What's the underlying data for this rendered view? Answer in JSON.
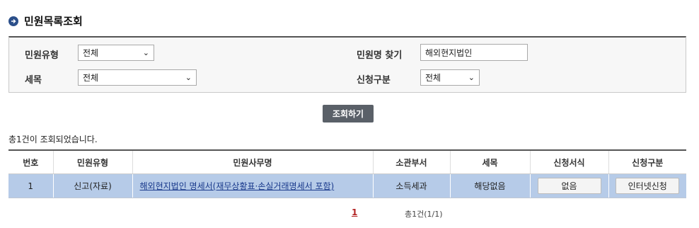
{
  "page": {
    "title": "민원목록조회"
  },
  "search": {
    "type_label": "민원유형",
    "type_value": "전체",
    "name_label": "민원명 찾기",
    "name_value": "해외현지법인",
    "tax_label": "세목",
    "tax_value": "전체",
    "apply_label": "신청구분",
    "apply_value": "전체",
    "button": "조회하기"
  },
  "result": {
    "count_text": "총1건이 조회되었습니다."
  },
  "table": {
    "headers": [
      "번호",
      "민원유형",
      "민원사무명",
      "소관부서",
      "세목",
      "신청서식",
      "신청구분"
    ],
    "rows": [
      {
        "no": "1",
        "type": "신고(자료)",
        "name": "해외현지법인 명세서(재무상황표·손실거래명세서 포함)",
        "dept": "소득세과",
        "tax": "해당없음",
        "form_button": "없음",
        "apply_button": "인터넷신청"
      }
    ]
  },
  "pager": {
    "current": "1",
    "total_text": "총1건(1/1)"
  },
  "icons": {
    "title": "arrow-circle-icon",
    "select": "chevron-down-icon"
  },
  "colors": {
    "row_bg": "#b6cbe8",
    "button_bg": "#5a6068",
    "title_icon": "#2b4f8a"
  }
}
